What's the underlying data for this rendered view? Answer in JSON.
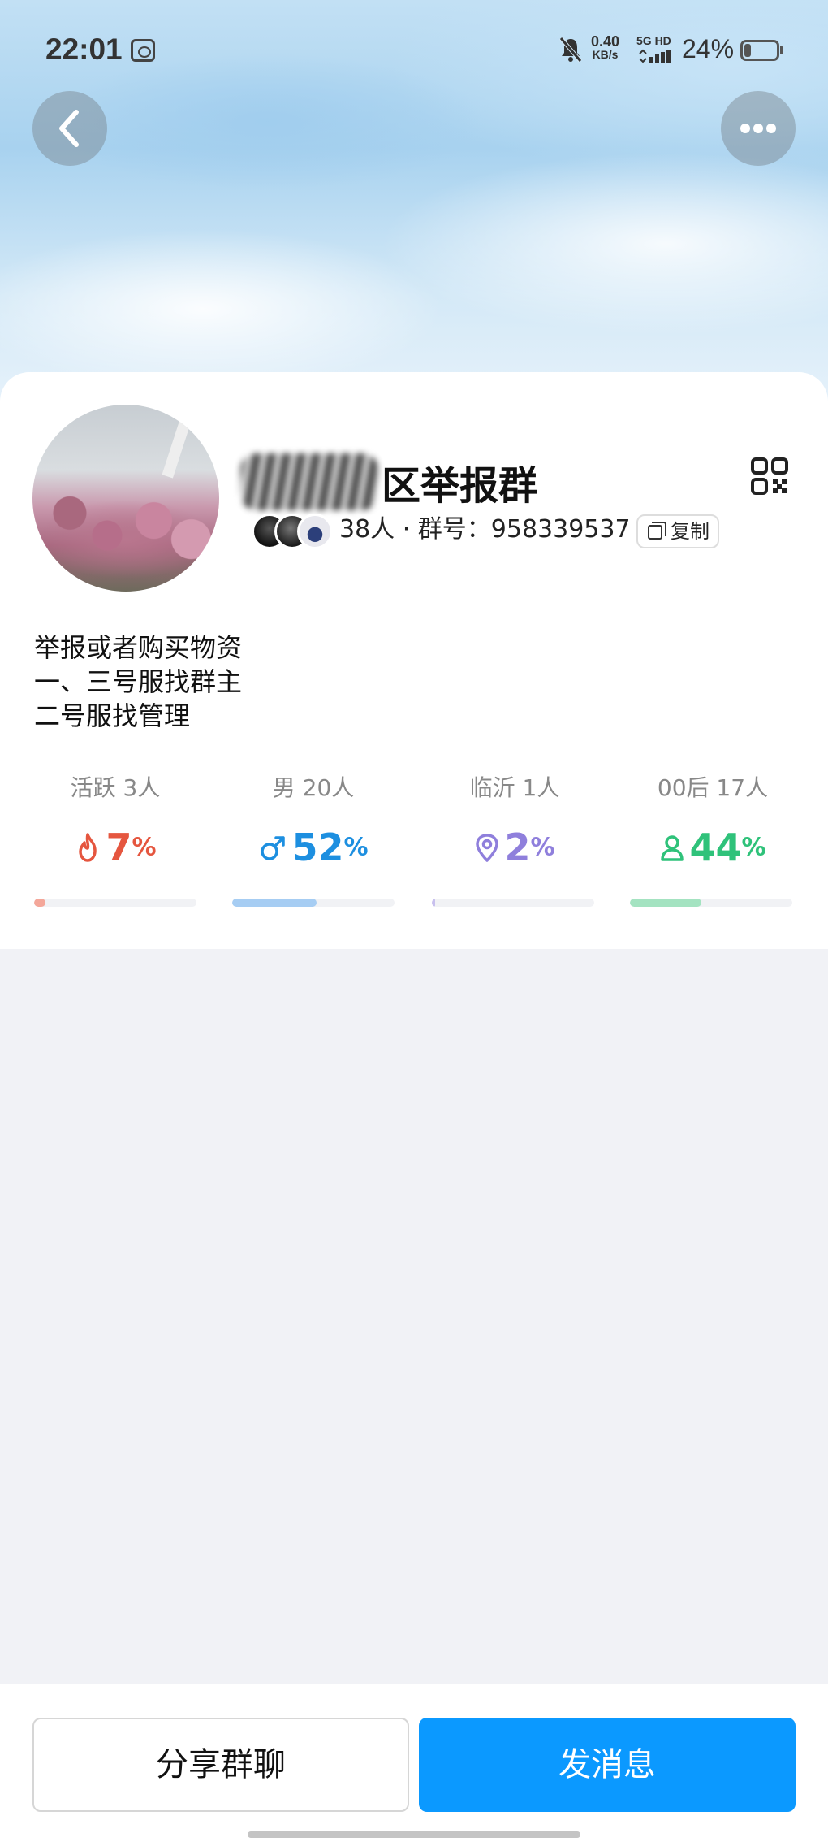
{
  "status_bar": {
    "time": "22:01",
    "net_speed_value": "0.40",
    "net_speed_unit": "KB/s",
    "network_type": "5G HD",
    "battery_percent": "24%",
    "battery_level": 0.24
  },
  "header": {
    "back_icon": "chevron-left-icon",
    "more_icon": "more-horizontal-icon"
  },
  "group": {
    "name_visible": "区举报群",
    "member_info": "38人 · 群号：958339537",
    "copy_label": "复制",
    "qr_icon": "qr-code-icon",
    "description": [
      "举报或者购买物资",
      "一、三号服找群主",
      "二号服找管理"
    ]
  },
  "stats": [
    {
      "label": "活跃 3人",
      "value": "7",
      "unit": "%",
      "icon": "flame-icon",
      "color": "#e5563f",
      "bar_color": "#f4a79a",
      "fraction": 0.07
    },
    {
      "label": "男 20人",
      "value": "52",
      "unit": "%",
      "icon": "male-icon",
      "color": "#1d8fe0",
      "bar_color": "#a6cdf3",
      "fraction": 0.52
    },
    {
      "label": "临沂 1人",
      "value": "2",
      "unit": "%",
      "icon": "location-pin-icon",
      "color": "#8f7fdc",
      "bar_color": "#c8c0ee",
      "fraction": 0.02
    },
    {
      "label": "00后 17人",
      "value": "44",
      "unit": "%",
      "icon": "person-icon",
      "color": "#2fc27a",
      "bar_color": "#a4e3c1",
      "fraction": 0.44
    }
  ],
  "actions": {
    "share_label": "分享群聊",
    "send_label": "发消息"
  },
  "colors": {
    "accent": "#0b99ff",
    "page_bg": "#f1f2f6"
  }
}
